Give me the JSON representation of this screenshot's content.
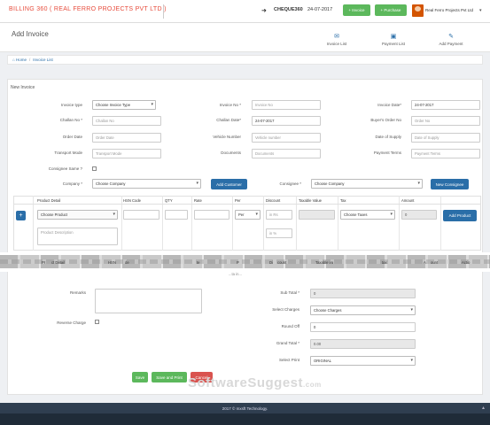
{
  "brand": "BILLING 360 ( REAL FERRO PROJECTS PVT LTD )",
  "topbar": {
    "cheque_label": "CHEQUE360",
    "date": "24-07-2017",
    "invoice_btn": "+ Invoice",
    "purchase_btn": "+ Purchase",
    "company_name": "Real Ferro Projects Pvt Ltd"
  },
  "page": {
    "title": "Add Invoice",
    "links": {
      "invoice_list": "Invoice List",
      "payment_list": "Payment List",
      "add_payment": "Add Payment"
    }
  },
  "breadcrumb": {
    "home": "Home",
    "sep": "/",
    "current": "Invoice List"
  },
  "section_title": "New Invoice",
  "form": {
    "invoice_type": {
      "label": "Invoice type",
      "value": "Choose Invoice Type"
    },
    "invoice_no": {
      "label": "Invoice No *",
      "placeholder": "Invoice No"
    },
    "invoice_date": {
      "label": "Invoice Date*",
      "value": "24-07-2017"
    },
    "challan_no": {
      "label": "Challan No *",
      "placeholder": "Challan No"
    },
    "challan_date": {
      "label": "Challan Date*",
      "value": "24-07-2017"
    },
    "buyer_order_no": {
      "label": "Buyer's Order No",
      "placeholder": "Order No"
    },
    "order_date": {
      "label": "Order Date",
      "placeholder": "Order Date"
    },
    "vehicle_number": {
      "label": "Vehicle Number",
      "placeholder": "Vehicle number"
    },
    "date_of_supply": {
      "label": "Date of Supply",
      "placeholder": "Date of Supply"
    },
    "transport_mode": {
      "label": "Transport Mode",
      "placeholder": "Transport Mode"
    },
    "documents": {
      "label": "Documents",
      "placeholder": "Documents"
    },
    "payment_terms": {
      "label": "Payment Terms",
      "placeholder": "Payment Terms"
    },
    "consignee_same": {
      "label": "Consignee Same ?"
    },
    "company": {
      "label": "Company *",
      "value": "Choose Company"
    },
    "add_customer_btn": "Add Customer",
    "consignee": {
      "label": "Consignee *",
      "value": "Choose Company"
    },
    "new_consignee_btn": "New Consignee"
  },
  "product_table": {
    "headers": [
      "Product Detail",
      "HSN Code",
      "QTY",
      "Rate",
      "Per",
      "Discount",
      "Taxable Value",
      "Tax",
      "Amount"
    ],
    "product_select": "Choose Product",
    "product_description": "Product Description",
    "per_select": "Per",
    "discount_rs": "in Rs",
    "discount_pct": "in %",
    "tax_select": "Choose Taxes",
    "amount_value": "0",
    "plus": "+",
    "add_product_btn": "Add Product"
  },
  "items_table": {
    "headers": [
      "Pr",
      "ct Detail",
      "HSN",
      "de",
      "te",
      "P",
      "Di",
      "count",
      "Taxable va",
      "tax",
      "A",
      "ount",
      "Actio"
    ],
    "empty_text": "...ta in..."
  },
  "summary": {
    "remarks_label": "Remarks",
    "reverse_charge_label": "Reverse Charge",
    "sub_total_label": "Sub Total *",
    "sub_total_value": "0",
    "select_charges_label": "Select Charges",
    "select_charges_value": "Choose Charges",
    "round_off_label": "Round Off",
    "round_off_value": "0",
    "grand_total_label": "Grand Total *",
    "grand_total_value": "0.00",
    "select_print_label": "Select Print",
    "select_print_value": "ORIGINAL"
  },
  "actions": {
    "save": "Save",
    "save_print": "Save and Print",
    "cancel": "Cancel"
  },
  "watermark": {
    "main": "SoftwareSuggest",
    "suffix": ".com"
  },
  "footer": "2017 © mxsft Technology."
}
